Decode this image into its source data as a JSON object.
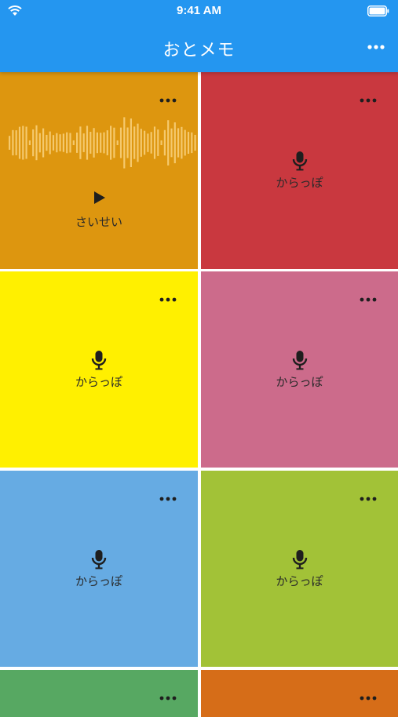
{
  "status_bar": {
    "time": "9:41 AM",
    "icons": [
      "wifi-icon",
      "battery-icon"
    ]
  },
  "header": {
    "title": "おとメモ",
    "menu_icon": "more-horizontal-icon"
  },
  "colors": {
    "header": "#2496f0",
    "orange_amber": "#dd960f",
    "red": "#c9383f",
    "yellow": "#fff000",
    "pink": "#cc6b8b",
    "light_blue": "#66abe3",
    "yellow_green": "#a2c237",
    "green": "#57a862",
    "orange": "#d66d18"
  },
  "tiles": [
    {
      "color": "#dd960f",
      "state": "recorded",
      "label": "さいせい",
      "icon": "play-icon",
      "has_waveform": true
    },
    {
      "color": "#c9383f",
      "state": "empty",
      "label": "からっぽ",
      "icon": "microphone-icon"
    },
    {
      "color": "#fff000",
      "state": "empty",
      "label": "からっぽ",
      "icon": "microphone-icon"
    },
    {
      "color": "#cc6b8b",
      "state": "empty",
      "label": "からっぽ",
      "icon": "microphone-icon"
    },
    {
      "color": "#66abe3",
      "state": "empty",
      "label": "からっぽ",
      "icon": "microphone-icon"
    },
    {
      "color": "#a2c237",
      "state": "empty",
      "label": "からっぽ",
      "icon": "microphone-icon"
    },
    {
      "color": "#57a862",
      "state": "empty",
      "label": "",
      "icon": ""
    },
    {
      "color": "#d66d18",
      "state": "empty",
      "label": "",
      "icon": ""
    }
  ]
}
